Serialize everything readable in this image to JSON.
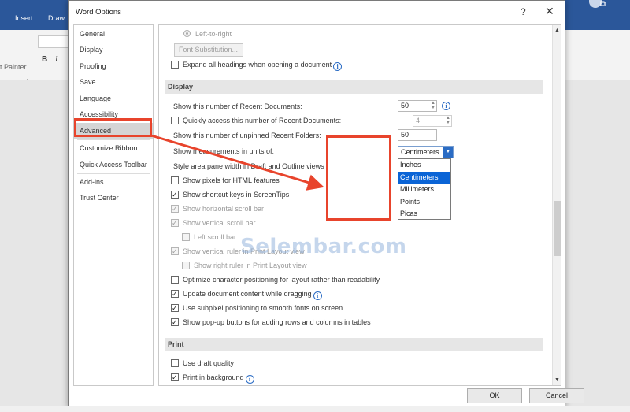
{
  "word": {
    "tabs": [
      "Insert",
      "Draw"
    ],
    "format_painter": "t Painter",
    "bold": "B",
    "italic": "I"
  },
  "dialog": {
    "title": "Word Options",
    "help": "?",
    "close": "✕",
    "ok": "OK",
    "cancel": "Cancel"
  },
  "nav": {
    "items": [
      "General",
      "Display",
      "Proofing",
      "Save",
      "Language",
      "Accessibility",
      "Advanced",
      "Customize Ribbon",
      "Quick Access Toolbar",
      "Add-ins",
      "Trust Center"
    ],
    "selected": "Advanced"
  },
  "content": {
    "ltr": "Left-to-right",
    "font_substitution": "Font Substitution...",
    "expand_headings": "Expand all headings when opening a document",
    "display_header": "Display",
    "recent_docs_label": "Show this number of Recent Documents:",
    "recent_docs_value": "50",
    "quick_access_label": "Quickly access this number of Recent Documents:",
    "quick_access_value": "4",
    "unpinned_label": "Show this number of unpinned Recent Folders:",
    "unpinned_value": "50",
    "units_label": "Show measurements in units of:",
    "units_value": "Centimeters",
    "style_pane_label": "Style area pane width in Draft and Outline views",
    "pixels": "Show pixels for HTML features",
    "shortcut_keys": "Show shortcut keys in ScreenTips",
    "hscroll": "Show horizontal scroll bar",
    "vscroll": "Show vertical scroll bar",
    "left_scroll": "Left scroll bar",
    "vruler": "Show vertical ruler in Print Layout view",
    "right_ruler": "Show right ruler in Print Layout view",
    "optimize": "Optimize character positioning for layout rather than readability",
    "update_dragging": "Update document content while dragging",
    "subpixel": "Use subpixel positioning to smooth fonts on screen",
    "popup": "Show pop-up buttons for adding rows and columns in tables",
    "print_header": "Print",
    "draft_quality": "Use draft quality",
    "print_background": "Print in background"
  },
  "units_options": [
    "Inches",
    "Centimeters",
    "Millimeters",
    "Points",
    "Picas"
  ],
  "units_selected": "Centimeters",
  "watermark": "Selembar.com",
  "colors": {
    "highlight": "#e8442c",
    "word_blue": "#2b579a",
    "selection": "#0a64d6"
  }
}
